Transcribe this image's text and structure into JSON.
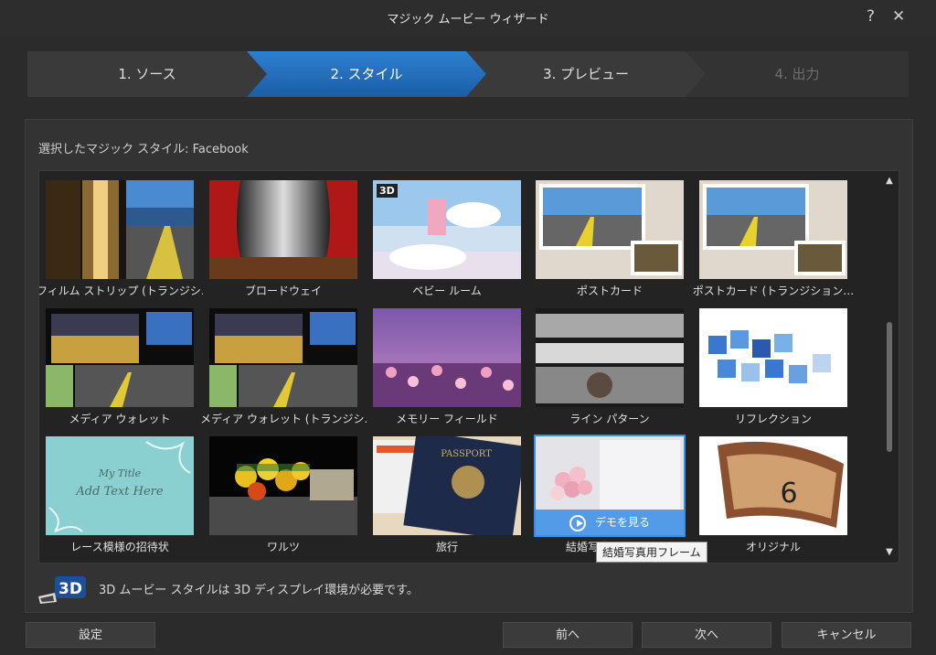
{
  "window": {
    "title": "マジック ムービー ウィザード",
    "help": "?",
    "close": "✕"
  },
  "steps": [
    {
      "label": "1. ソース"
    },
    {
      "label": "2. スタイル"
    },
    {
      "label": "3. プレビュー"
    },
    {
      "label": "4. 出力"
    }
  ],
  "selected_style_label": "選択したマジック スタイル:  Facebook",
  "tiles": [
    {
      "label": "フィルム ストリップ (トランジシ…"
    },
    {
      "label": "ブロードウェイ"
    },
    {
      "label": "ベビー ルーム",
      "badge": "3D"
    },
    {
      "label": "ポストカード"
    },
    {
      "label": "ポストカード (トランジション…"
    },
    {
      "label": "メディア ウォレット"
    },
    {
      "label": "メディア ウォレット (トランジシ…"
    },
    {
      "label": "メモリー フィールド"
    },
    {
      "label": "ライン パターン"
    },
    {
      "label": "リフレクション"
    },
    {
      "label": "レース模様の招待状",
      "thumb_text": [
        "My Title",
        "Add Text Here"
      ]
    },
    {
      "label": "ワルツ"
    },
    {
      "label": "旅行",
      "thumb_text": [
        "PASSPORT"
      ]
    },
    {
      "label": "結婚写真用フレ…",
      "demo": "デモを見る"
    },
    {
      "label": "オリジナル"
    }
  ],
  "tooltip": "結婚写真用フレーム",
  "scroll": {
    "up": "▲",
    "down": "▼"
  },
  "note": {
    "icon_text": "3D",
    "text": "3D ムービー スタイルは 3D ディスプレイ環境が必要です。"
  },
  "buttons": {
    "settings": "設定",
    "back": "前へ",
    "next": "次へ",
    "cancel": "キャンセル"
  },
  "colors": {
    "accent": "#2e7fd0",
    "background": "#2b2b2b",
    "selection": "#3a8ee6"
  }
}
